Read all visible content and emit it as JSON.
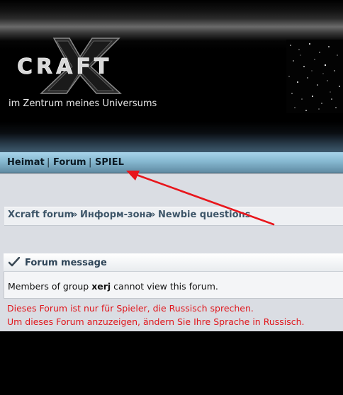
{
  "header": {
    "logo_text": "CRAFT",
    "tagline": "im Zentrum meines Universums"
  },
  "nav": {
    "items": [
      {
        "label": "Heimat"
      },
      {
        "label": "Forum"
      },
      {
        "label": "SPIEL"
      }
    ],
    "separator": "|"
  },
  "breadcrumb": {
    "items": [
      {
        "label": "Xcraft forum"
      },
      {
        "label": "Информ-зона"
      },
      {
        "label": "Newbie questions"
      }
    ],
    "separator": "»"
  },
  "message": {
    "title": "Forum message",
    "text_before": "Members of group ",
    "group": "xerj",
    "text_after": " cannot view this forum."
  },
  "notice": {
    "line1": "Dieses Forum ist nur für Spieler, die Russisch sprechen.",
    "line2": "Um dieses Forum anzuzeigen, ändern Sie Ihre Sprache in Russisch."
  },
  "colors": {
    "annotation_arrow": "#e8161c",
    "notice_text": "#e0161c",
    "navbar": "#86b8d0"
  }
}
